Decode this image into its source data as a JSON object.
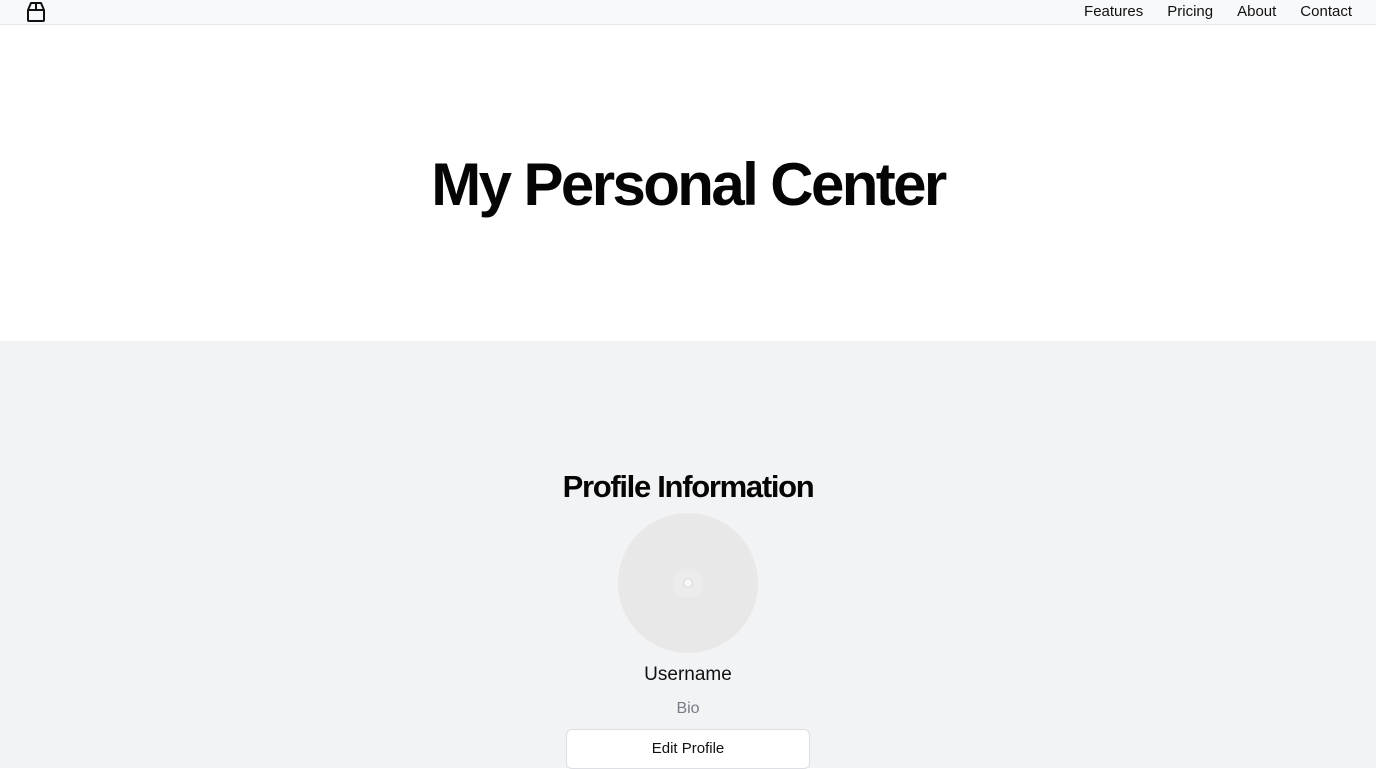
{
  "header": {
    "logo_icon": "shopping-bag-icon",
    "nav": [
      {
        "label": "Features"
      },
      {
        "label": "Pricing"
      },
      {
        "label": "About"
      },
      {
        "label": "Contact"
      }
    ]
  },
  "hero": {
    "title": "My Personal Center"
  },
  "profile": {
    "section_title": "Profile Information",
    "avatar_icon": "avatar-placeholder-icon",
    "username": "Username",
    "bio": "Bio",
    "edit_button_label": "Edit Profile"
  },
  "colors": {
    "header_background": "#f8f9fa",
    "page_background": "#ffffff",
    "section_background": "#f2f3f5",
    "avatar_background": "#e8e8e8",
    "muted_text": "#777c85"
  }
}
